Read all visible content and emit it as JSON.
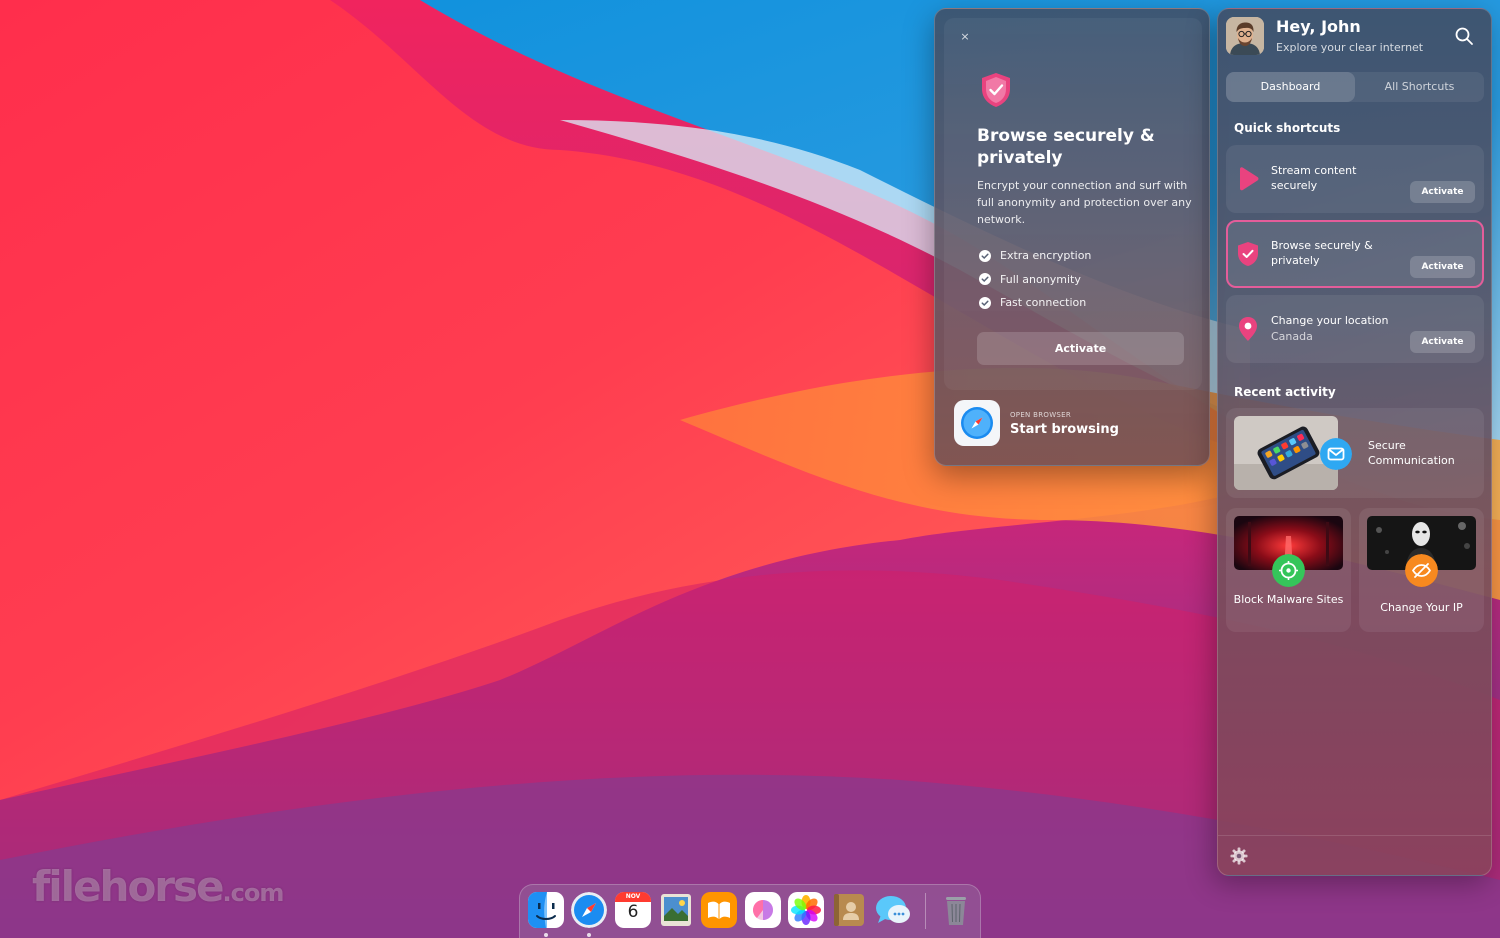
{
  "watermark": {
    "brand": "filehorse",
    "suffix": ".com"
  },
  "popover": {
    "close": "×",
    "title": "Browse securely & privately",
    "description": "Encrypt your connection and surf with full anonymity and protection over any network.",
    "features": [
      "Extra encryption",
      "Full anonymity",
      "Fast connection"
    ],
    "activate": "Activate",
    "browser_label": "OPEN BROWSER",
    "browser_title": "Start browsing"
  },
  "panel": {
    "greeting": "Hey, John",
    "subtitle": "Explore your clear internet",
    "tabs": [
      "Dashboard",
      "All Shortcuts"
    ],
    "active_tab": "Dashboard",
    "quick_title": "Quick shortcuts",
    "shortcuts": [
      {
        "label": "Stream content securely",
        "sub": "",
        "button": "Activate",
        "icon": "play-icon"
      },
      {
        "label": "Browse securely & privately",
        "sub": "",
        "button": "Activate",
        "icon": "shield-icon",
        "selected": true
      },
      {
        "label": "Change your location",
        "sub": "Canada",
        "button": "Activate",
        "icon": "location-pin-icon"
      }
    ],
    "recent_title": "Recent activity",
    "activities": [
      {
        "label": "Secure Communication",
        "icon": "mail-icon"
      },
      {
        "label": "Block Malware Sites",
        "icon": "malware-icon"
      },
      {
        "label": "Change Your IP",
        "icon": "hidden-eye-icon"
      }
    ]
  },
  "dock": {
    "apps": [
      "finder",
      "safari",
      "calendar",
      "preview",
      "books",
      "clearvpn",
      "photos",
      "contacts",
      "messages",
      "trash"
    ],
    "calendar": {
      "month": "NOV",
      "day": "6"
    }
  },
  "colors": {
    "accent_pink": "#e9437f",
    "selected_border": "#e45d9a",
    "check_white": "#ffffff"
  }
}
